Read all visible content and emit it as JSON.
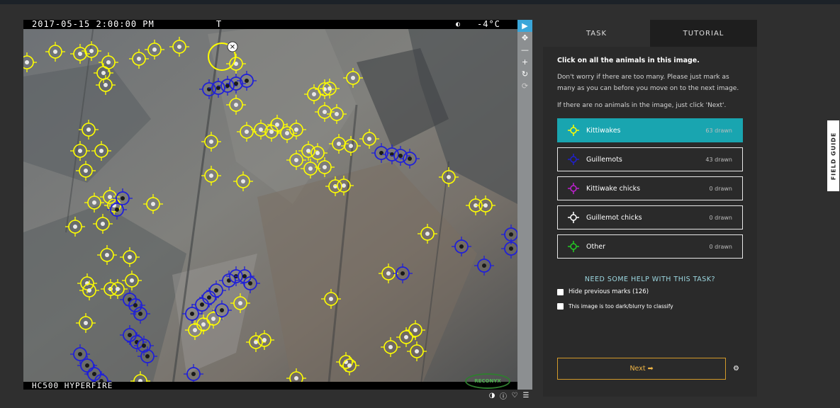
{
  "camera": {
    "timestamp": "2017-05-15 2:00:00 PM",
    "flag": "T",
    "moon_icon": "moon-phase-icon",
    "temperature": "-4°C",
    "model": "HC500 HYPERFIRE",
    "brand": "RECONYX"
  },
  "tools": [
    {
      "name": "pointer-tool",
      "icon": "cursor-arrow-icon",
      "glyph": "▶"
    },
    {
      "name": "move-tool",
      "icon": "move-icon",
      "glyph": "✥"
    },
    {
      "name": "zoom-out-tool",
      "icon": "minus-icon",
      "glyph": "—"
    },
    {
      "name": "zoom-in-tool",
      "icon": "plus-icon",
      "glyph": "+"
    },
    {
      "name": "rotate-tool",
      "icon": "rotate-icon",
      "glyph": "↻"
    },
    {
      "name": "reset-tool",
      "icon": "reset-icon",
      "glyph": "⟳"
    }
  ],
  "bottom_icons": [
    "contrast-icon",
    "info-icon",
    "favorite-icon",
    "collections-icon"
  ],
  "tabs": {
    "task": "TASK",
    "tutorial": "TUTORIAL"
  },
  "task": {
    "question": "Click on all the animals in this image.",
    "help1": "Don't worry if there are too many. Please just mark as many as you can before you move on to the next image.",
    "help2": "If there are no animals in the image, just click 'Next'.",
    "choices": [
      {
        "label": "Kittiwakes",
        "count": "63 drawn",
        "color": "#ffff00",
        "selected": true
      },
      {
        "label": "Guillemots",
        "count": "43 drawn",
        "color": "#1f1fd0",
        "selected": false
      },
      {
        "label": "Kittiwake chicks",
        "count": "0 drawn",
        "color": "#c020d0",
        "selected": false
      },
      {
        "label": "Guillemot chicks",
        "count": "0 drawn",
        "color": "#ffffff",
        "selected": false
      },
      {
        "label": "Other",
        "count": "0 drawn",
        "color": "#22cc22",
        "selected": false
      }
    ],
    "need_help": "NEED SOME HELP WITH THIS TASK?",
    "hide_marks": "Hide previous marks (126)",
    "too_dark": "This image is too dark/blurry to classify",
    "next": "Next ➡"
  },
  "field_guide": "FIELD GUIDE",
  "colors": {
    "kittiwake": "#ffff00",
    "guillemot": "#1f1fd0",
    "selected": "#19a5b0",
    "next": "#d39a2a"
  }
}
